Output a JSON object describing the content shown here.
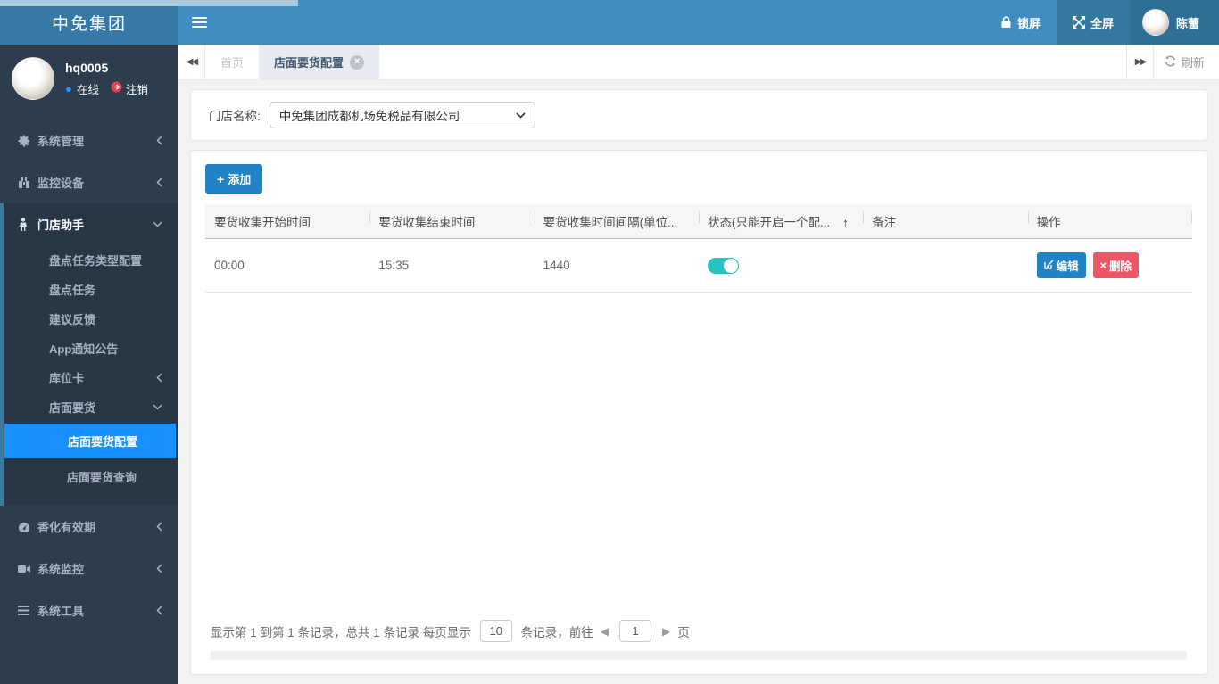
{
  "colors": {
    "header_blue": "#3f8dc1",
    "logo_blue": "#3779a6",
    "sidebar_dark": "#2c3e4e",
    "active_blue": "#1890ff",
    "toggle_teal": "#25c4c1",
    "danger_red": "#ee5566",
    "button_blue": "#1f83c5"
  },
  "header": {
    "logo": "中免集团",
    "lock_label": "锁屏",
    "fullscreen_label": "全屏",
    "username": "陈蕾"
  },
  "sidebar": {
    "user": {
      "name": "hq0005",
      "status": "在线",
      "logout": "注销"
    },
    "menu": [
      {
        "label": "系统管理"
      },
      {
        "label": "监控设备"
      },
      {
        "label": "门店助手",
        "children": [
          {
            "label": "盘点任务类型配置"
          },
          {
            "label": "盘点任务"
          },
          {
            "label": "建议反馈"
          },
          {
            "label": "App通知公告"
          },
          {
            "label": "库位卡"
          },
          {
            "label": "店面要货",
            "children": [
              {
                "label": "店面要货配置"
              },
              {
                "label": "店面要货查询"
              }
            ]
          }
        ]
      },
      {
        "label": "香化有效期"
      },
      {
        "label": "系统监控"
      },
      {
        "label": "系统工具"
      }
    ]
  },
  "tabs": {
    "home": "首页",
    "active": "店面要货配置",
    "refresh": "刷新"
  },
  "filter": {
    "label": "门店名称:",
    "value": "中免集团成都机场免税品有限公司"
  },
  "toolbar": {
    "add_label": "添加"
  },
  "table": {
    "columns": [
      "要货收集开始时间",
      "要货收集结束时间",
      "要货收集时间间隔(单位...",
      "状态(只能开启一个配...",
      "备注",
      "操作"
    ],
    "rows": [
      {
        "start_time": "00:00",
        "end_time": "15:35",
        "interval": "1440",
        "status": "on",
        "remark": ""
      }
    ],
    "actions": {
      "edit": "编辑",
      "delete": "删除"
    }
  },
  "pagination": {
    "text_before_size": "显示第 1 到第 1 条记录，总共 1 条记录 每页显示",
    "page_size": "10",
    "text_after_size": "条记录，前往",
    "page": "1",
    "text_page_suffix": "页"
  },
  "icons": {
    "back": "◀◀",
    "forward": "▶▶",
    "prev": "◀",
    "next": "▶",
    "sort_up": "↑",
    "online_dot": "●",
    "plus": "+",
    "close": "×",
    "delete_x": "×"
  }
}
